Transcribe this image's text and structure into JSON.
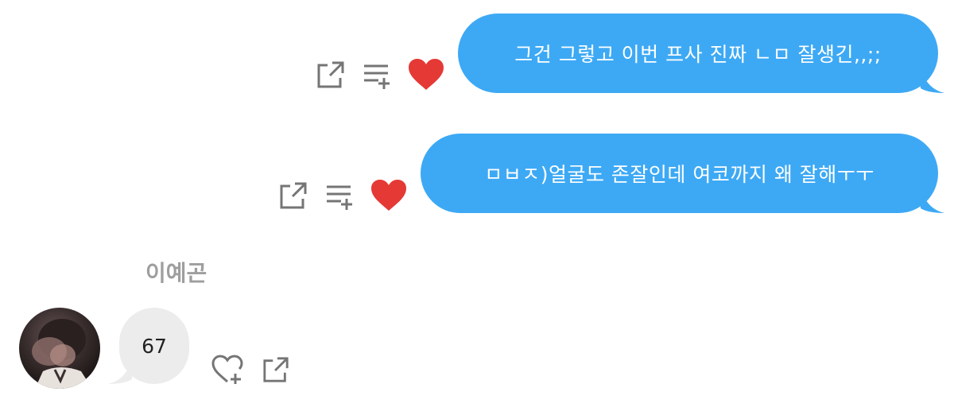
{
  "messages": [
    {
      "text": "그건 그렇고 이번 프사 진짜 ㄴㅁ 잘생긴,,;;",
      "liked": true
    },
    {
      "text": "ㅁㅂㅈ)얼굴도 존잘인데 여코까지 왜 잘해ㅜㅜ",
      "liked": true
    }
  ],
  "incoming": {
    "sender_name": "이예곤",
    "text": "67"
  },
  "colors": {
    "outgoing_bubble": "#3da9f5",
    "incoming_bubble": "#ececec",
    "heart": "#e53935",
    "icon": "#757575"
  },
  "icons": {
    "share": "share-icon",
    "add_to_playlist": "add-to-playlist-icon",
    "liked": "heart-filled-icon",
    "like": "heart-add-icon"
  }
}
